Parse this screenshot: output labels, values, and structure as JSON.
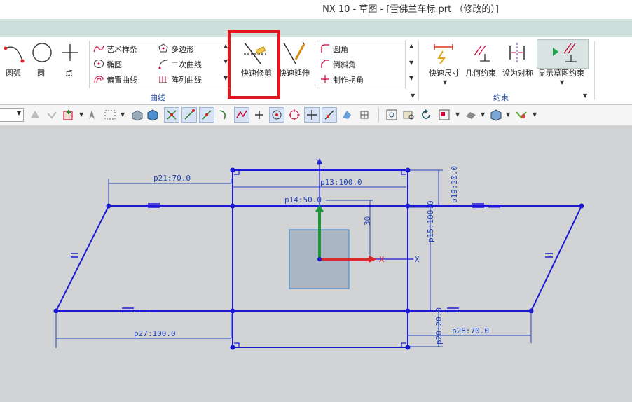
{
  "window": {
    "title": "NX 10 - 草图 - [雪佛兰车标.prt （修改的）]"
  },
  "ribbon": {
    "curve_group": {
      "group_label": "曲线",
      "arc_label": "圆弧",
      "circle_label": "圆",
      "point_label": "点",
      "studio_spline": "艺术样条",
      "ellipse": "椭圆",
      "offset_curve": "偏置曲线",
      "polygon": "多边形",
      "conic": "二次曲线",
      "pattern_curve": "阵列曲线",
      "quick_trim": "快速修剪",
      "quick_extend": "快速延伸",
      "fillet": "圆角",
      "chamfer": "倒斜角",
      "make_corner": "制作拐角"
    },
    "constraints_group": {
      "group_label": "约束",
      "rapid_dimension": "快速尺寸",
      "geometric_constraints": "几何约束",
      "make_symmetric": "设为对称",
      "display_sketch_constraints": "显示草图约束"
    }
  },
  "sketch": {
    "dimensions": {
      "p21": "p21:70.0",
      "p13": "p13:100.0",
      "p14": "p14:50.0",
      "p19": "p19:20.0",
      "p15": "p15:100.0",
      "p27": "p27:100.0",
      "p28": "p28:70.0",
      "p20": "p20:20.0",
      "offset_30": "30"
    },
    "axis_labels": {
      "x": "X",
      "y": "Y",
      "x_csys": "X"
    },
    "equal_symbol": "="
  },
  "colors": {
    "sketch_line": "#1a1ad6",
    "dimension": "#2243b8",
    "highlight": "#e5161c",
    "canvas_bg": "#d2d3d5"
  }
}
